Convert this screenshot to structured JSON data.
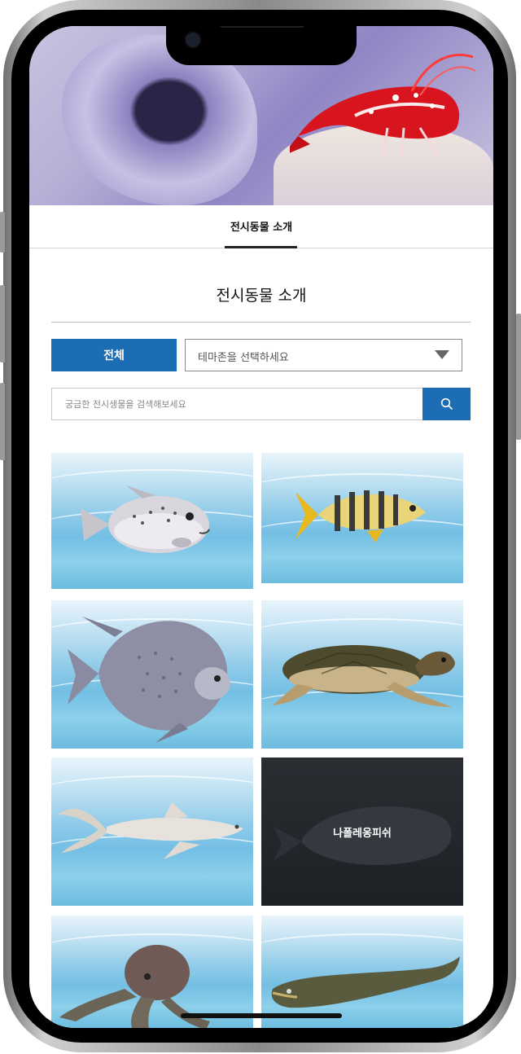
{
  "tabs": [
    {
      "label": "전시동물 소개",
      "active": true
    }
  ],
  "page": {
    "title": "전시동물 소개"
  },
  "filter": {
    "all_label": "전체",
    "theme_select_value": "테마존을 선택하세요"
  },
  "search": {
    "placeholder": "궁금한 전시생물을 검색해보세요"
  },
  "cards": [
    {
      "creature": "pufferfish"
    },
    {
      "creature": "golden-trevally"
    },
    {
      "creature": "angelfish"
    },
    {
      "creature": "sea-turtle"
    },
    {
      "creature": "pale-fish"
    },
    {
      "creature": "napoleon-wrasse",
      "label": "나폴레옹피쉬",
      "hovered": true
    },
    {
      "creature": "octopus"
    },
    {
      "creature": "eel-fish"
    }
  ],
  "colors": {
    "accent": "#1c6db4",
    "tab_underline": "#222222"
  }
}
